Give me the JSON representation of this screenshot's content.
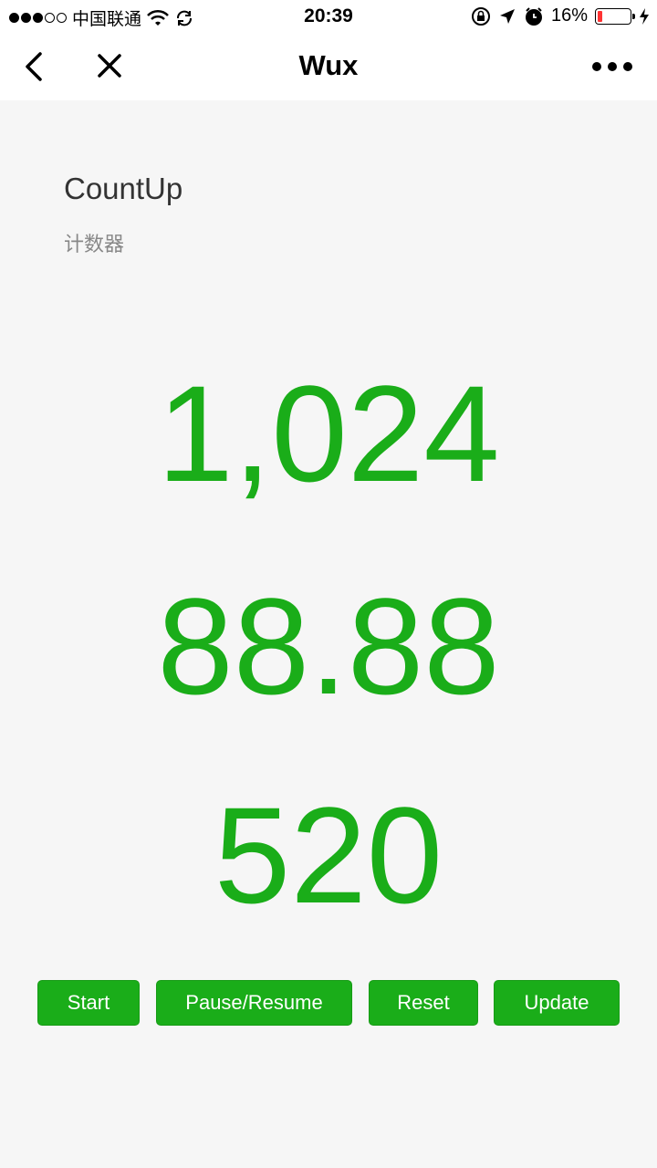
{
  "status_bar": {
    "carrier": "中国联通",
    "time": "20:39",
    "battery_percent": "16%",
    "battery_level": 0.16,
    "signal_bars": 3,
    "signal_total": 5
  },
  "nav": {
    "title": "Wux",
    "back_icon": "chevron-left-icon",
    "close_icon": "close-icon",
    "more_icon": "more-dots-icon"
  },
  "page": {
    "title": "CountUp",
    "description": "计数器"
  },
  "counters": [
    "1,024",
    "88.88",
    "520"
  ],
  "buttons": {
    "start": "Start",
    "pause_resume": "Pause/Resume",
    "reset": "Reset",
    "update": "Update"
  },
  "colors": {
    "accent": "#1aad19",
    "background": "#f6f6f6"
  }
}
